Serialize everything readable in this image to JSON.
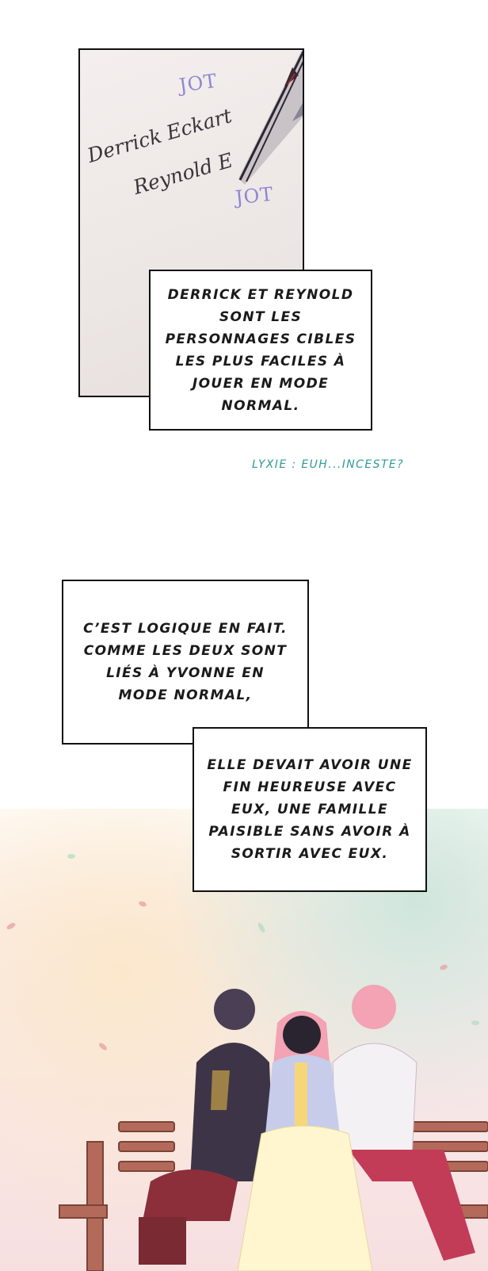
{
  "notebook": {
    "stamp_top": "JOT",
    "stamp_bottom": "JOT",
    "name_line_1": "Derrick Eckart",
    "name_line_2": "Reynold E",
    "pen_icon": "fountain-pen-icon"
  },
  "captions": {
    "first": "Derrick et Reynold sont les personnages cibles les plus faciles à jouer en mode normal.",
    "second": "C’est logique en fait. Comme les deux sont liés à Yvonne en mode normal,",
    "third": "elle devait avoir une fin heureuse avec eux, une famille paisible sans avoir à sortir avec eux."
  },
  "translator_note": "LYXIE : EUH...INCESTE?",
  "colors": {
    "stamp": "#8f86d2",
    "note": "#2f9a94",
    "sky_pink": "#f7dfe0",
    "tree_green": "#cfe6dc",
    "bench": "#b46a5a",
    "hair_pink": "#f3a3b3",
    "coat_dark": "#3d3547"
  }
}
